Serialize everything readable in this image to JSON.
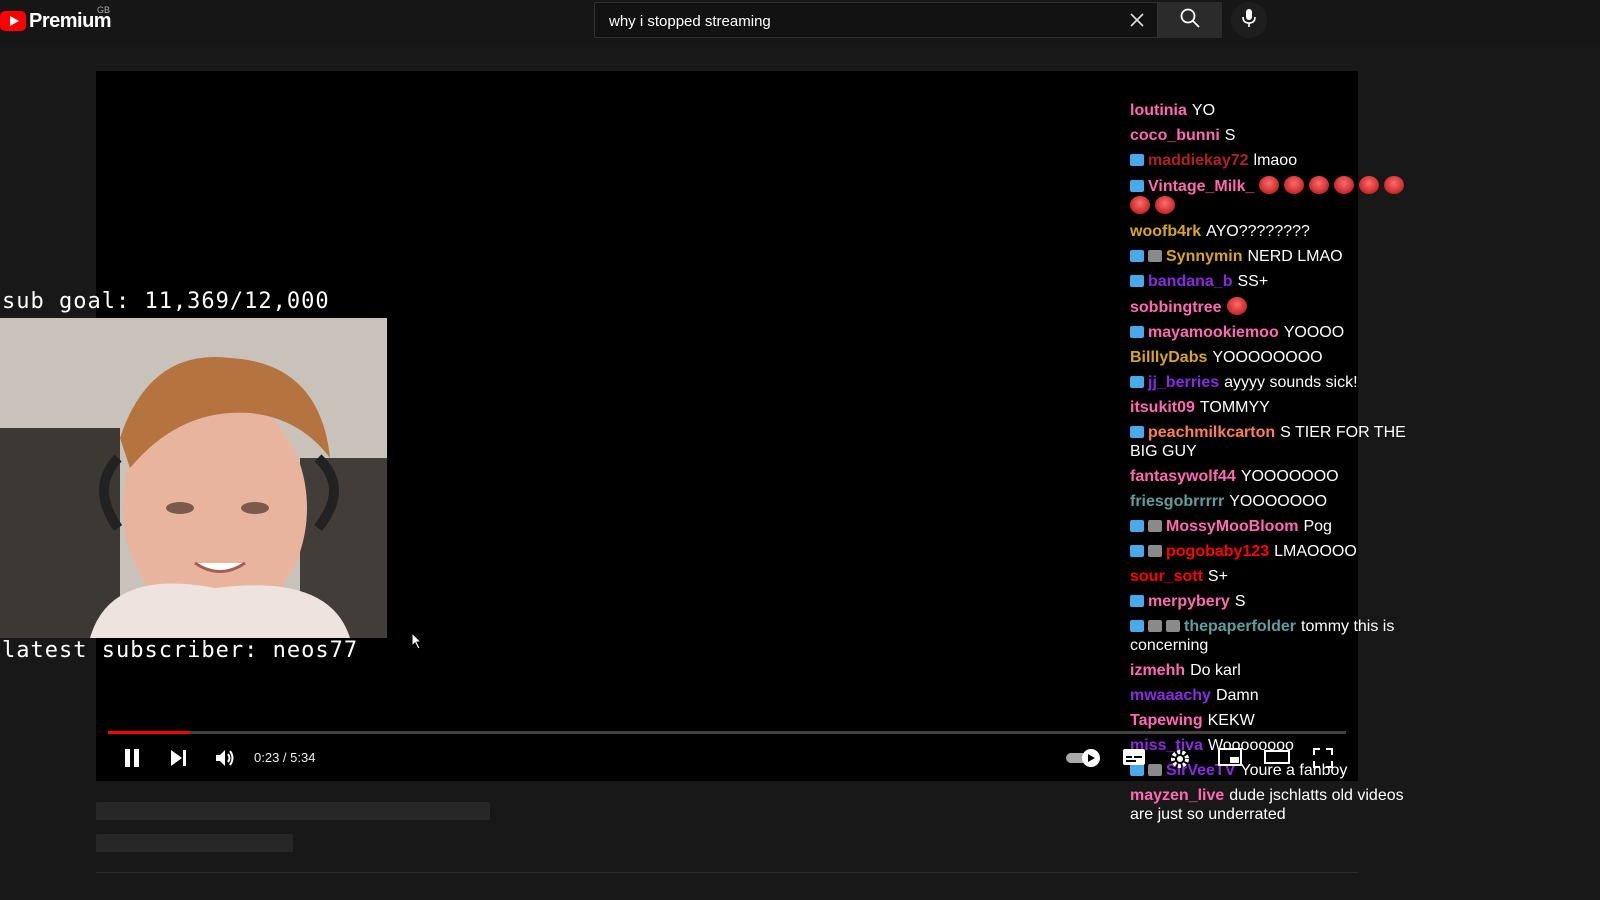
{
  "masthead": {
    "logo_text": "Premium",
    "region": "GB",
    "search_value": "why i stopped streaming",
    "icons": [
      "youtube-logo-icon",
      "close-icon",
      "search-icon",
      "mic-icon"
    ]
  },
  "overlay": {
    "sub_goal": "sub goal: 11,369/12,000",
    "latest_subscriber": "latest subscriber: neos77"
  },
  "chat": [
    {
      "user": "loutinia",
      "text": "YO",
      "color": "#ff69b4",
      "badges": 0
    },
    {
      "user": "coco_bunni",
      "text": "S",
      "color": "#ff69b4",
      "badges": 0
    },
    {
      "user": "maddiekay72",
      "text": "lmaoo",
      "color": "#b22222",
      "badges": 1
    },
    {
      "user": "Vintage_Milk_",
      "text": "",
      "color": "#ff69b4",
      "badges": 1,
      "emotes": 8
    },
    {
      "user": "woofb4rk",
      "text": "AYO????????",
      "color": "#daa520",
      "badges": 0
    },
    {
      "user": "Synnymin",
      "text": "NERD LMAO",
      "color": "#daa520",
      "badges": 2
    },
    {
      "user": "bandana_b",
      "text": "SS+",
      "color": "#8a2be2",
      "badges": 1
    },
    {
      "user": "sobbingtree",
      "text": "",
      "color": "#ff69b4",
      "badges": 0,
      "emotes": 1
    },
    {
      "user": "mayamookiemoo",
      "text": "YOOOO",
      "color": "#ff69b4",
      "badges": 1
    },
    {
      "user": "BilllyDabs",
      "text": "YOOOOOOOO",
      "color": "#daa520",
      "badges": 0
    },
    {
      "user": "jj_berries",
      "text": "ayyyy sounds sick!",
      "color": "#8a2be2",
      "badges": 1
    },
    {
      "user": "itsukit09",
      "text": "TOMMYY",
      "color": "#ff69b4",
      "badges": 0
    },
    {
      "user": "peachmilkcarton",
      "text": "S TIER FOR THE BIG GUY",
      "color": "#ff7f50",
      "badges": 1
    },
    {
      "user": "fantasywolf44",
      "text": "YOOOOOOO",
      "color": "#ff69b4",
      "badges": 0
    },
    {
      "user": "friesgobrrrrr",
      "text": "YOOOOOOO",
      "color": "#5f9ea0",
      "badges": 0
    },
    {
      "user": "MossyMooBloom",
      "text": "Pog",
      "color": "#ff69b4",
      "badges": 2
    },
    {
      "user": "pogobaby123",
      "text": "LMAOOOO",
      "color": "#ff0000",
      "badges": 2
    },
    {
      "user": "sour_sott",
      "text": "S+",
      "color": "#ff0000",
      "badges": 0
    },
    {
      "user": "merpybery",
      "text": "S",
      "color": "#ff69b4",
      "badges": 1
    },
    {
      "user": "thepaperfolder",
      "text": "tommy this is concerning",
      "color": "#5f9ea0",
      "badges": 3
    },
    {
      "user": "izmehh",
      "text": "Do karl",
      "color": "#ff69b4",
      "badges": 0
    },
    {
      "user": "mwaaachy",
      "text": "Damn",
      "color": "#8a2be2",
      "badges": 0
    },
    {
      "user": "Tapewing",
      "text": "KEKW",
      "color": "#ff69b4",
      "badges": 0
    },
    {
      "user": "miss_tiva",
      "text": "Woooooooo",
      "color": "#8a2be2",
      "badges": 0
    },
    {
      "user": "SirVeeTV",
      "text": "Youre a fanboy",
      "color": "#8a2be2",
      "badges": 2
    },
    {
      "user": "mayzen_live",
      "text": "dude jschlatts old videos are just so underrated",
      "color": "#ff69b4",
      "badges": 0
    }
  ],
  "player": {
    "time": "0:23 / 5:34",
    "progress_fraction": 0.066,
    "accent": "#ff0000",
    "autoplay": true
  }
}
